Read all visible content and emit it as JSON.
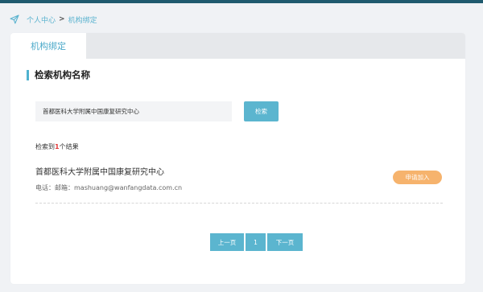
{
  "colors": {
    "accent": "#5bb5cf",
    "join_button": "#f6b36d",
    "result_count": "#e23a3a",
    "top_strip": "#1f5a6e"
  },
  "breadcrumb": {
    "icon": "location-arrow-icon",
    "items": [
      "个人中心",
      "机构绑定"
    ],
    "separator": ">"
  },
  "tabs": [
    {
      "label": "机构绑定",
      "active": true
    }
  ],
  "section": {
    "title": "检索机构名称"
  },
  "search": {
    "value": "首都医科大学附属中国康复研究中心",
    "placeholder": "",
    "button_label": "检索"
  },
  "results": {
    "summary_prefix": "检索到",
    "count": "1",
    "summary_suffix": "个结果",
    "items": [
      {
        "name": "首都医科大学附属中国康复研究中心",
        "contact": "电话：邮箱：mashuang@wanfangdata.com.cn",
        "action_label": "申请加入"
      }
    ]
  },
  "pagination": {
    "prev_label": "上一页",
    "current_page": "1",
    "next_label": "下一页"
  }
}
